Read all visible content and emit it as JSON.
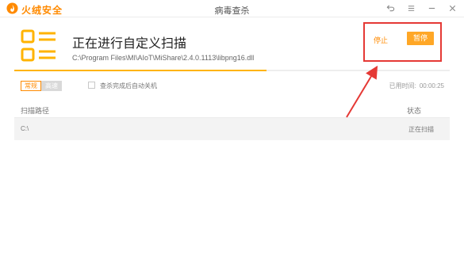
{
  "app": {
    "brand": "火绒安全",
    "window_title": "病毒查杀",
    "window_buttons": [
      "back-icon",
      "menu-icon",
      "minimize-icon",
      "close-icon"
    ]
  },
  "scan": {
    "title": "正在进行自定义扫描",
    "current_path": "C:\\Program Files\\MI\\AIoT\\MiShare\\2.4.0.1113\\libpng16.dll",
    "progress_percent": 58
  },
  "actions": {
    "stop_label": "停止",
    "pause_label": "暂停"
  },
  "mode": {
    "options": [
      {
        "label": "常规",
        "state": "active"
      },
      {
        "label": "高速",
        "state": "disabled"
      }
    ]
  },
  "shutdown_option": {
    "label": "查杀完成后自动关机",
    "checked": false
  },
  "elapsed": {
    "label": "已用时间:",
    "value": "00:00:25"
  },
  "table": {
    "columns": [
      "扫描路径",
      "状态"
    ],
    "rows": [
      {
        "path": "C:\\",
        "status": "正在扫描"
      }
    ]
  },
  "colors": {
    "accent": "#ff8a00",
    "pause_button": "#ffa726",
    "progress": "#ffb300",
    "annotation": "#e53935"
  }
}
